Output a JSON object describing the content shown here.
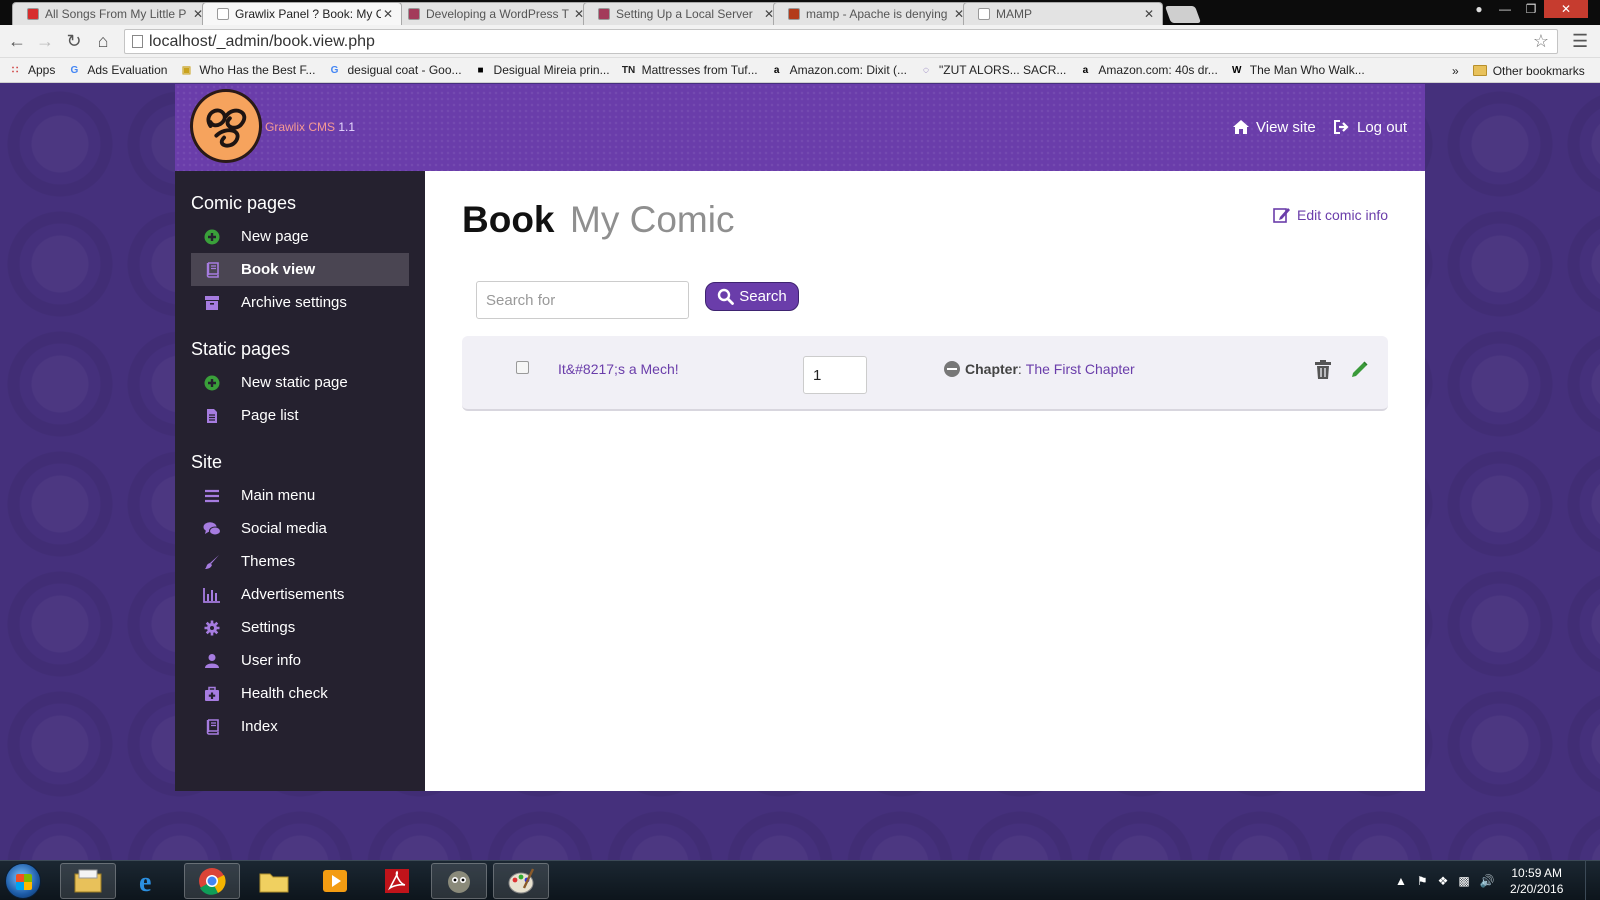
{
  "browser": {
    "tabs": [
      {
        "title": "All Songs From My Little P",
        "favicon": "youtube-icon",
        "color": "#d72c2c"
      },
      {
        "title": "Grawlix Panel ? Book: My C",
        "favicon": "page-icon",
        "color": "#ffffff"
      },
      {
        "title": "Developing a WordPress T",
        "favicon": "tutsplus-icon",
        "color": "#a33a5a"
      },
      {
        "title": "Setting Up a Local Server",
        "favicon": "tutsplus-icon",
        "color": "#a33a5a"
      },
      {
        "title": "mamp - Apache is denying",
        "favicon": "stackoverflow-icon",
        "color": "#b33b1b"
      },
      {
        "title": "MAMP",
        "favicon": "page-icon",
        "color": "#ffffff"
      }
    ],
    "url": "localhost/_admin/book.view.php",
    "bookmarks": [
      {
        "label": "Apps",
        "icon": "apps-grid-icon"
      },
      {
        "label": "Ads Evaluation",
        "icon": "google-icon"
      },
      {
        "label": "Who Has the Best F...",
        "icon": "photo-icon"
      },
      {
        "label": "desigual coat - Goo...",
        "icon": "google-icon"
      },
      {
        "label": "Desigual Mireia prin...",
        "icon": "black-square-icon"
      },
      {
        "label": "Mattresses from Tuf...",
        "icon": "tn-icon"
      },
      {
        "label": "Amazon.com: Dixit (...",
        "icon": "amazon-icon"
      },
      {
        "label": "\"ZUT ALORS... SACR...",
        "icon": "chat-icon"
      },
      {
        "label": "Amazon.com: 40s dr...",
        "icon": "amazon-icon"
      },
      {
        "label": "The Man Who Walk...",
        "icon": "wikipedia-icon"
      }
    ],
    "overflow": "»",
    "other_bookmarks": "Other bookmarks"
  },
  "header": {
    "brand": "Grawlix CMS",
    "version": "1.1",
    "view_site": "View site",
    "log_out": "Log out",
    "accent": "#6a3daa"
  },
  "sidebar": {
    "sections": [
      {
        "heading": "Comic pages",
        "items": [
          {
            "label": "New page",
            "icon": "plus-circle-icon",
            "active": false
          },
          {
            "label": "Book view",
            "icon": "book-icon",
            "active": true
          },
          {
            "label": "Archive settings",
            "icon": "archive-icon",
            "active": false
          }
        ]
      },
      {
        "heading": "Static pages",
        "items": [
          {
            "label": "New static page",
            "icon": "plus-circle-icon",
            "active": false
          },
          {
            "label": "Page list",
            "icon": "file-icon",
            "active": false
          }
        ]
      },
      {
        "heading": "Site",
        "items": [
          {
            "label": "Main menu",
            "icon": "menu-bars-icon",
            "active": false
          },
          {
            "label": "Social media",
            "icon": "chat-bubbles-icon",
            "active": false
          },
          {
            "label": "Themes",
            "icon": "paintbrush-icon",
            "active": false
          },
          {
            "label": "Advertisements",
            "icon": "bar-chart-icon",
            "active": false
          },
          {
            "label": "Settings",
            "icon": "gear-icon",
            "active": false
          },
          {
            "label": "User info",
            "icon": "user-icon",
            "active": false
          },
          {
            "label": "Health check",
            "icon": "medkit-icon",
            "active": false
          },
          {
            "label": "Index",
            "icon": "book-icon",
            "active": false
          }
        ]
      }
    ]
  },
  "main": {
    "title": "Book",
    "subtitle": "My Comic",
    "edit_info": "Edit comic info",
    "search": {
      "placeholder": "Search for",
      "value": "",
      "button": "Search"
    },
    "rows": [
      {
        "title": "It&#8217;s a Mech!",
        "sort": "1",
        "chapter_label": "Chapter",
        "chapter_name": "The First Chapter",
        "checked": false
      }
    ]
  },
  "taskbar": {
    "apps": [
      "file-explorer-icon",
      "internet-explorer-icon",
      "chrome-icon",
      "folder-icon",
      "media-player-icon",
      "acrobat-icon",
      "gimp-icon",
      "paint-icon"
    ],
    "time": "10:59 AM",
    "date": "2/20/2016"
  }
}
